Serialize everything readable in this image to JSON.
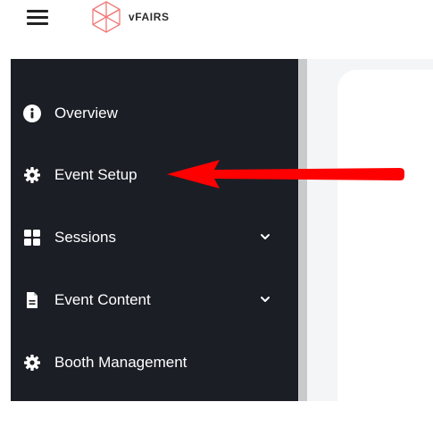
{
  "header": {
    "menu_icon": "hamburger-icon",
    "logo_icon": "vfairs-cube-icon",
    "logo_text": "vFAIRS"
  },
  "sidebar": {
    "items": [
      {
        "label": "Overview",
        "icon": "info-circle-icon",
        "has_chevron": false
      },
      {
        "label": "Event Setup",
        "icon": "gear-icon",
        "has_chevron": false
      },
      {
        "label": "Sessions",
        "icon": "grid-icon",
        "has_chevron": true
      },
      {
        "label": "Event Content",
        "icon": "document-icon",
        "has_chevron": true
      },
      {
        "label": "Booth Management",
        "icon": "gear-icon",
        "has_chevron": false
      }
    ]
  },
  "annotation": {
    "arrow_icon": "red-arrow-icon",
    "arrow_color": "#ff0000"
  },
  "colors": {
    "sidebar_bg": "#1c1e26",
    "logo_accent": "#f07a7a"
  }
}
